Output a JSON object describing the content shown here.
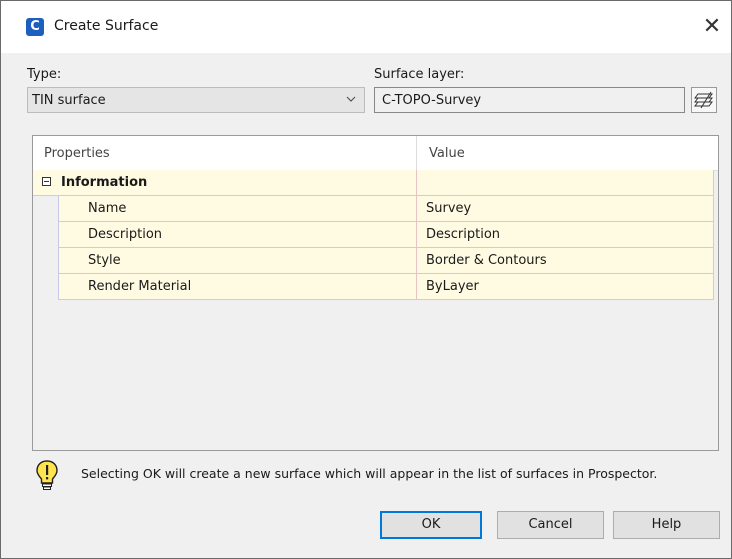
{
  "dialog": {
    "title": "Create Surface",
    "app_icon_letter": "C",
    "close_glyph": "✕"
  },
  "type": {
    "label": "Type:",
    "selected": "TIN surface"
  },
  "surface_layer": {
    "label": "Surface layer:",
    "value": "C-TOPO-Survey",
    "button_icon": "layers-icon"
  },
  "grid": {
    "headers": {
      "properties": "Properties",
      "value": "Value"
    },
    "group": "Information",
    "rows": [
      {
        "property": "Name",
        "value": "Survey"
      },
      {
        "property": "Description",
        "value": "Description"
      },
      {
        "property": "Style",
        "value": "Border & Contours"
      },
      {
        "property": "Render Material",
        "value": "ByLayer"
      }
    ]
  },
  "message": "Selecting OK will create a new surface which will appear in the list of surfaces in Prospector.",
  "buttons": {
    "ok": "OK",
    "cancel": "Cancel",
    "help": "Help"
  },
  "colors": {
    "accent": "#0078d7",
    "row_background": "#fffbe3",
    "app_icon": "#1d5fbf"
  }
}
